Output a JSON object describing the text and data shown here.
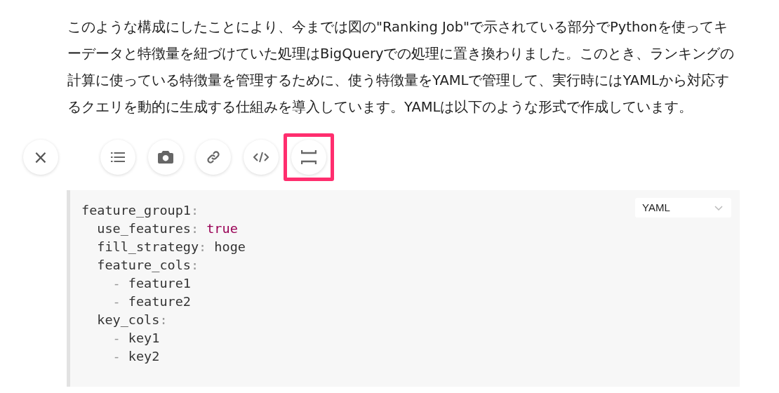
{
  "paragraph": "このような構成にしたことにより、今までは図の\"Ranking Job\"で示されている部分でPythonを使ってキーデータと特徴量を紐づけていた処理はBigQueryでの処理に置き換わりました。このとき、ランキングの計算に使っている特徴量を管理するために、使う特徴量をYAMLで管理して、実行時にはYAMLから対応するクエリを動的に生成する仕組みを導入しています。YAMLは以下のような形式で作成しています。",
  "toolbar": {
    "close": {
      "label": "×"
    },
    "buttons": [
      {
        "kind": "list",
        "selected": false
      },
      {
        "kind": "camera",
        "selected": false
      },
      {
        "kind": "link",
        "selected": false
      },
      {
        "kind": "code",
        "selected": false
      },
      {
        "kind": "divider",
        "selected": true
      }
    ]
  },
  "code_block": {
    "language": "YAML",
    "lines": [
      [
        {
          "text": "feature_group1",
          "kind": "plain"
        },
        {
          "text": ":",
          "kind": "punct"
        }
      ],
      [
        {
          "text": "  use_features",
          "kind": "plain"
        },
        {
          "text": ":",
          "kind": "punct"
        },
        {
          "text": " true",
          "kind": "bool"
        }
      ],
      [
        {
          "text": "  fill_strategy",
          "kind": "plain"
        },
        {
          "text": ":",
          "kind": "punct"
        },
        {
          "text": " hoge",
          "kind": "plain"
        }
      ],
      [
        {
          "text": "  feature_cols",
          "kind": "plain"
        },
        {
          "text": ":",
          "kind": "punct"
        }
      ],
      [
        {
          "text": "    -",
          "kind": "punct"
        },
        {
          "text": " feature1",
          "kind": "plain"
        }
      ],
      [
        {
          "text": "    -",
          "kind": "punct"
        },
        {
          "text": " feature2",
          "kind": "plain"
        }
      ],
      [
        {
          "text": "  key_cols",
          "kind": "plain"
        },
        {
          "text": ":",
          "kind": "punct"
        }
      ],
      [
        {
          "text": "    -",
          "kind": "punct"
        },
        {
          "text": " key1",
          "kind": "plain"
        }
      ],
      [
        {
          "text": "    -",
          "kind": "punct"
        },
        {
          "text": " key2",
          "kind": "plain"
        }
      ]
    ]
  }
}
